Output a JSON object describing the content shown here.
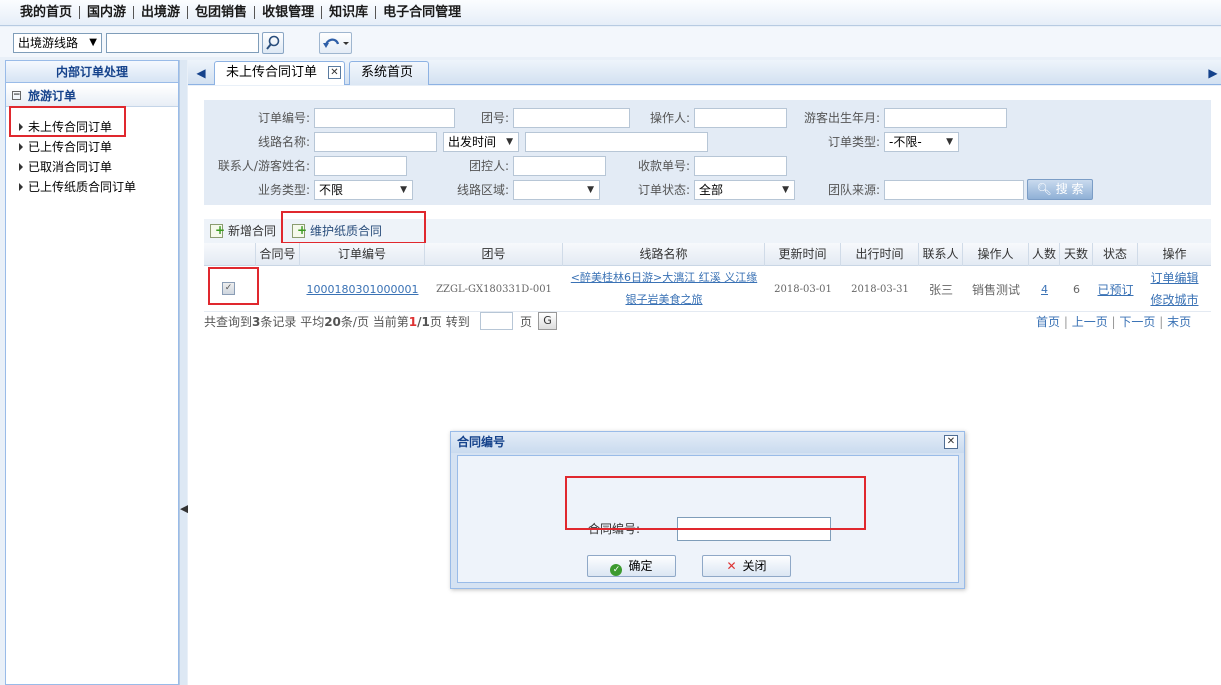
{
  "top_menu": [
    "我的首页",
    "国内游",
    "出境游",
    "包团销售",
    "收银管理",
    "知识库",
    "电子合同管理"
  ],
  "toolbar": {
    "route_type": "出境游线路",
    "search_value": ""
  },
  "left_panel": {
    "title": "内部订单处理",
    "group": "旅游订单",
    "items": [
      "未上传合同订单",
      "已上传合同订单",
      "已取消合同订单",
      "已上传纸质合同订单"
    ]
  },
  "tabs": [
    {
      "label": "未上传合同订单",
      "active": true
    },
    {
      "label": "系统首页",
      "active": false
    }
  ],
  "filters": {
    "order_no": "订单编号:",
    "group_no": "团号:",
    "operator": "操作人:",
    "birth_month": "游客出生年月:",
    "route_name": "线路名称:",
    "depart_time": "出发时间",
    "order_type": "订单类型:",
    "order_type_value": "-不限-",
    "contact_name": "联系人/游客姓名:",
    "group_controller": "团控人:",
    "receipt_no": "收款单号:",
    "business_type": "业务类型:",
    "business_type_value": "不限",
    "route_area": "线路区域:",
    "route_area_value": "",
    "order_status": "订单状态:",
    "order_status_value": "全部",
    "team_source": "团队来源:",
    "search_button": "搜 索"
  },
  "actions": {
    "add_contract": "新增合同",
    "maintain_paper": "维护纸质合同"
  },
  "table": {
    "headers": [
      "合同号",
      "订单编号",
      "团号",
      "线路名称",
      "更新时间",
      "出行时间",
      "联系人",
      "操作人",
      "人数",
      "天数",
      "状态",
      "操作"
    ],
    "rows": [
      {
        "contract_no": "",
        "order_no": "1000180301000001",
        "group_no": "ZZGL-GX180331D-001",
        "route_line1": "<醉美桂林6日游>大漓江 红溪 义江缘",
        "route_line2": "银子岩美食之旅",
        "update_time": "2018-03-01",
        "travel_time": "2018-03-31",
        "contact": "张三",
        "operator": "销售测试",
        "people": "4",
        "days": "6",
        "status": "已预订",
        "op1": "订单编辑",
        "op2": "修改城市"
      }
    ]
  },
  "pager": {
    "summary_prefix": "共查询到",
    "total": "3",
    "summary_mid": "条记录 平均",
    "per_page": "20",
    "summary_mid2": "条/页 当前第",
    "current": "1",
    "slash": "/",
    "pages": "1",
    "summary_suffix": "页 转到",
    "page_word": "页",
    "go": "G",
    "first": "首页",
    "prev": "上一页",
    "next": "下一页",
    "last": "末页"
  },
  "dialog": {
    "title": "合同编号",
    "label": "合同编号:",
    "value": "",
    "ok": "确定",
    "close": "关闭"
  }
}
